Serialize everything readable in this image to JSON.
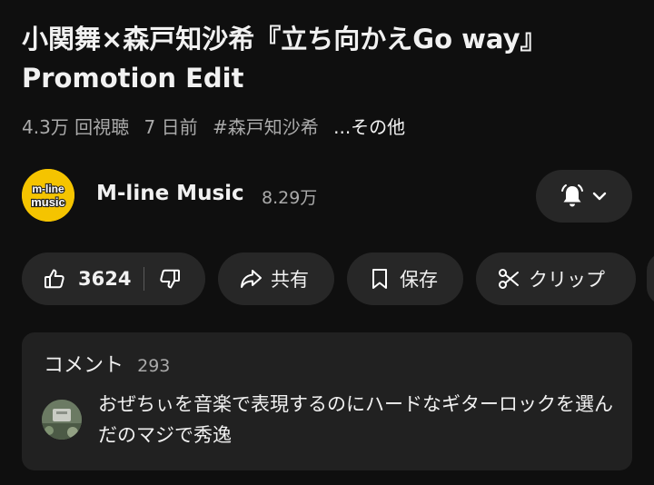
{
  "video": {
    "title": "小関舞×森戸知沙希『立ち向かえGo way』Promotion Edit",
    "views": "4.3万 回視聴",
    "age": "7 日前",
    "hashtag": "#森戸知沙希",
    "more": "...その他"
  },
  "channel": {
    "name": "M-line Music",
    "subscribers": "8.29万",
    "avatar_text_top": "m-line",
    "avatar_text_bottom": "music",
    "avatar_color": "#f5c400"
  },
  "actions": {
    "like_count": "3624",
    "share_label": "共有",
    "save_label": "保存",
    "clip_label": "クリップ"
  },
  "icons": {
    "like": "thumbs-up-icon",
    "dislike": "thumbs-down-icon",
    "share": "share-arrow-icon",
    "save": "bookmark-icon",
    "clip": "scissors-icon",
    "bell": "bell-icon",
    "chevron": "chevron-down-icon"
  },
  "comments": {
    "label": "コメント",
    "count": "293",
    "top_comment": "おぜちぃを音楽で表現するのにハードなギターロックを選んだのマジで秀逸"
  }
}
